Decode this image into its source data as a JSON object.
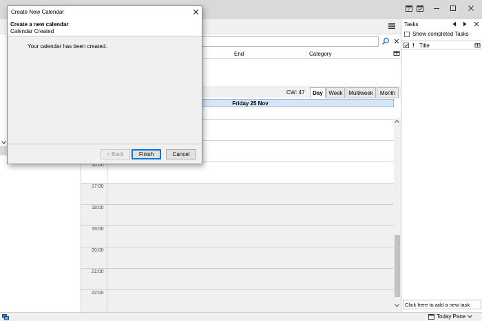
{
  "dialog": {
    "title": "Create New Calendar",
    "heading": "Create a new calendar",
    "subheading": "Calendar Created",
    "message": "Your calendar has been created.",
    "back_label": "< Back",
    "finish_label": "Finish",
    "cancel_label": "Cancel"
  },
  "event_list": {
    "columns": [
      "End",
      "Category"
    ]
  },
  "view_bar": {
    "cw_label": "CW: 47",
    "tabs": [
      "Day",
      "Week",
      "Multiweek",
      "Month"
    ],
    "active_tab": "Day"
  },
  "day_view": {
    "date_header": "Friday 25 Nov",
    "hours": [
      "16:00",
      "17:00",
      "18:00",
      "19:00",
      "20:00",
      "21:00",
      "22:00"
    ]
  },
  "tasks": {
    "title": "Tasks",
    "show_completed_label": "Show completed Tasks",
    "show_completed_checked": false,
    "column_title": "Title",
    "add_task_placeholder": "Click here to add a new task"
  },
  "statusbar": {
    "today_pane_label": "Today Pane"
  },
  "colors": {
    "day_header_bg": "#d6e6f6",
    "primary_button_border": "#0078d7"
  }
}
